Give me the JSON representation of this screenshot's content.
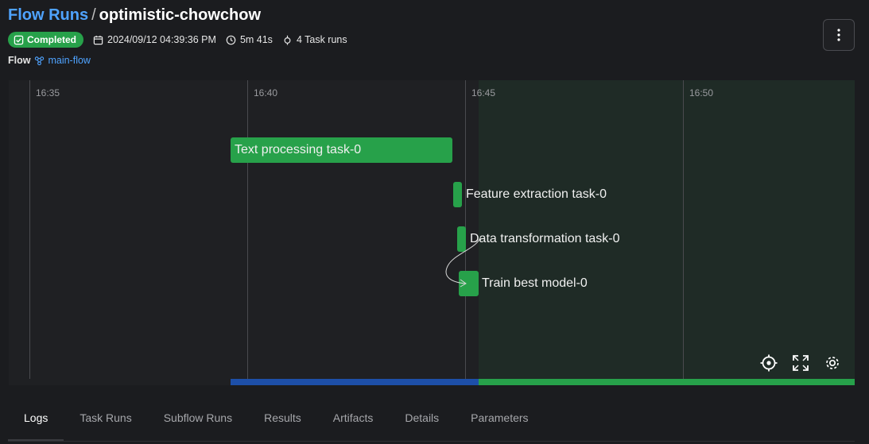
{
  "header": {
    "breadcrumb_root": "Flow Runs",
    "breadcrumb_sep": "/",
    "run_name": "optimistic-chowchow",
    "status": "Completed",
    "timestamp": "2024/09/12 04:39:36 PM",
    "duration": "5m 41s",
    "task_runs": "4 Task runs",
    "flow_label": "Flow",
    "flow_name": "main-flow"
  },
  "timeline": {
    "ticks": [
      "16:35",
      "16:40",
      "16:45",
      "16:50"
    ],
    "tasks": [
      {
        "name": "Text processing task-0"
      },
      {
        "name": "Feature extraction task-0"
      },
      {
        "name": "Data transformation task-0"
      },
      {
        "name": "Train best model-0"
      }
    ],
    "controls": [
      "recenter-icon",
      "fullscreen-icon",
      "settings-gear-icon"
    ]
  },
  "tabs": [
    "Logs",
    "Task Runs",
    "Subflow Runs",
    "Results",
    "Artifacts",
    "Details",
    "Parameters"
  ],
  "active_tab": "Logs",
  "colors": {
    "accent_blue": "#4fa3ff",
    "success_green": "#27a14a",
    "progress_blue": "#1d4fa8",
    "background": "#1b1c1f"
  }
}
